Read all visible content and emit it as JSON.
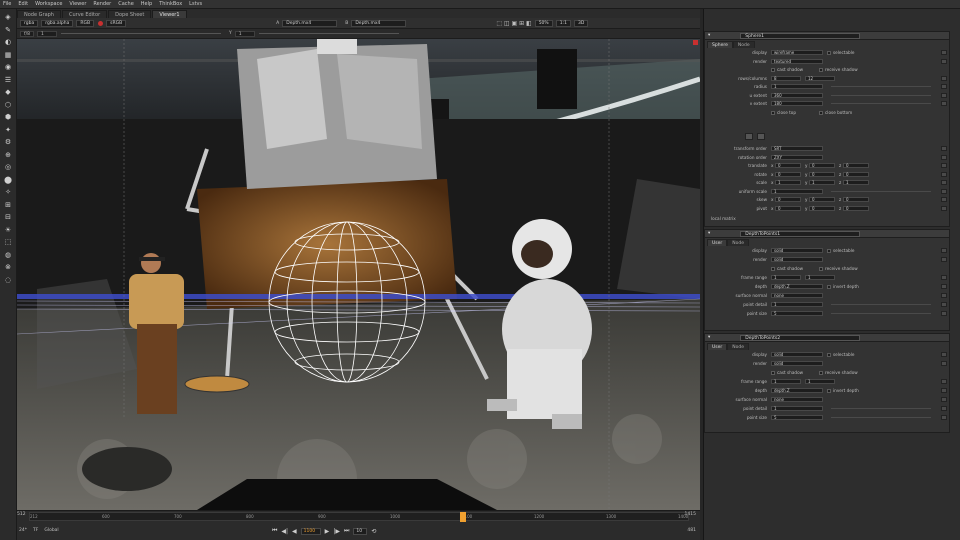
{
  "menu": [
    "File",
    "Edit",
    "Workspace",
    "Viewer",
    "Render",
    "Cache",
    "Help",
    "ThinkBox",
    "Lstvs"
  ],
  "left_tabs": [
    "Node Graph",
    "Curve Editor",
    "Dope Sheet",
    "Viewer1"
  ],
  "right_tabs": [
    "Properties",
    "Script Editor"
  ],
  "viewer_toolbar": {
    "channels": "rgba",
    "alpha": "rgba.alpha",
    "colorspace": "RGB",
    "input_a": "A",
    "input_a_value": "Depth.mx4",
    "input_b": "B",
    "input_b_value": "Depth.mx4",
    "zoom": "50%",
    "ratio": "1:1",
    "view": "3D"
  },
  "viewer_toolbar2": {
    "frame_label": "f/8",
    "frame_value": "1",
    "y_label": "Y",
    "y_value": "1"
  },
  "timeline": {
    "ticks": [
      "212",
      "600",
      "700",
      "800",
      "900",
      "1000",
      "1100",
      "1200",
      "1300",
      "1400"
    ],
    "fps_label": "24*",
    "tf_label": "TF",
    "global": "Global",
    "current_frame": "1100",
    "end": "1415",
    "frame_field": "10",
    "end_field": "481"
  },
  "sphere": {
    "title": "Sphere1",
    "tabs": [
      "Sphere",
      "Node"
    ],
    "rows": [
      {
        "label": "display",
        "value": "wireframe",
        "check": "selectable"
      },
      {
        "label": "render",
        "value": "textured"
      },
      {
        "label": "",
        "check": "cast shadow",
        "check2": "receive shadow"
      },
      {
        "label": "rows/columns",
        "value": "8",
        "value2": "12"
      },
      {
        "label": "radius",
        "value": "1"
      },
      {
        "label": "u extent",
        "value": "360"
      },
      {
        "label": "v extent",
        "value": "180"
      },
      {
        "label": "",
        "check": "close top",
        "check2": "close bottom"
      }
    ],
    "xform": [
      {
        "label": "transform order",
        "value": "SRT"
      },
      {
        "label": "rotation order",
        "value": "ZXY"
      },
      {
        "label": "translate",
        "x": "0",
        "y": "0",
        "z": "0"
      },
      {
        "label": "rotate",
        "x": "0",
        "y": "0",
        "z": "0"
      },
      {
        "label": "scale",
        "x": "1",
        "y": "1",
        "z": "1"
      },
      {
        "label": "uniform scale",
        "value": "1"
      },
      {
        "label": "skew",
        "x": "0",
        "y": "0",
        "z": "0"
      },
      {
        "label": "pivot",
        "x": "0",
        "y": "0",
        "z": "0"
      }
    ],
    "local_matrix": "local matrix"
  },
  "d1": {
    "title": "DepthToPoints1",
    "tabs": [
      "User",
      "Node"
    ],
    "rows": [
      {
        "label": "display",
        "value": "solid",
        "check": "selectable"
      },
      {
        "label": "render",
        "value": "solid"
      },
      {
        "label": "",
        "check": "cast shadow",
        "check2": "receive shadow"
      },
      {
        "label": "frame range",
        "value": "1",
        "value2": "1"
      },
      {
        "label": "depth",
        "value": "depth.Z",
        "check": "invert depth"
      },
      {
        "label": "surface normal",
        "value": "none"
      },
      {
        "label": "point detail",
        "value": "1"
      },
      {
        "label": "point size",
        "value": "5"
      }
    ]
  },
  "d2": {
    "title": "DepthToPoints2",
    "tabs": [
      "User",
      "Node"
    ],
    "rows": [
      {
        "label": "display",
        "value": "solid",
        "check": "selectable"
      },
      {
        "label": "render",
        "value": "solid"
      },
      {
        "label": "",
        "check": "cast shadow",
        "check2": "receive shadow"
      },
      {
        "label": "frame range",
        "value": "1",
        "value2": "1"
      },
      {
        "label": "depth",
        "value": "depth.Z",
        "check": "invert depth"
      },
      {
        "label": "surface normal",
        "value": "none"
      },
      {
        "label": "point detail",
        "value": "1"
      },
      {
        "label": "point size",
        "value": "5"
      }
    ]
  },
  "colors": {
    "accent": "#f0a030",
    "red": "#c83030",
    "wire": "#ffffff",
    "bluestrip": "#3d4cc8"
  }
}
